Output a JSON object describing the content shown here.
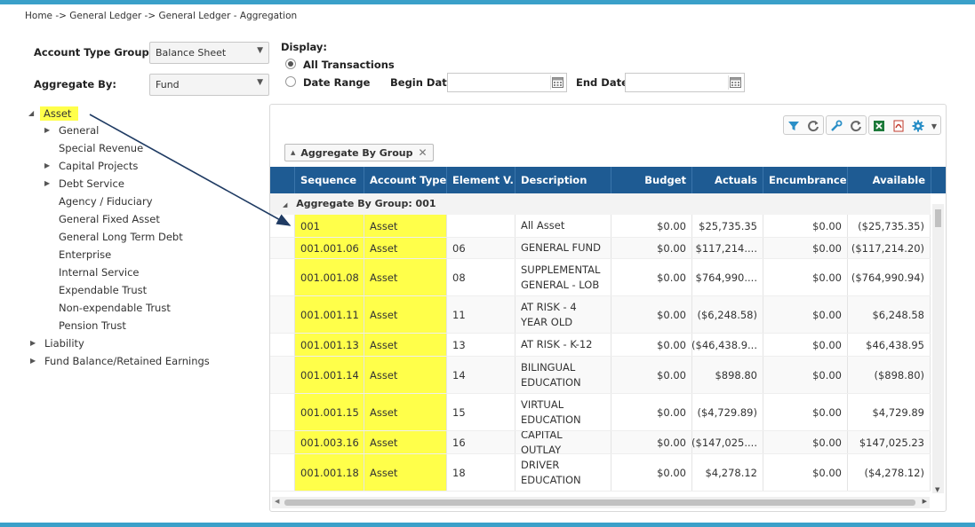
{
  "breadcrumb": "Home -> General Ledger -> General Ledger - Aggregation",
  "filters": {
    "account_type_group_label": "Account Type Group:",
    "account_type_group_value": "Balance Sheet",
    "aggregate_by_label": "Aggregate By:",
    "aggregate_by_value": "Fund",
    "display_label": "Display:",
    "all_transactions_label": "All Transactions",
    "date_range_label": "Date Range",
    "begin_date_label": "Begin Date",
    "end_date_label": "End Date",
    "begin_date_value": "",
    "end_date_value": ""
  },
  "tree": {
    "root": "Asset",
    "children": [
      "General",
      "Special Revenue",
      "Capital Projects",
      "Debt Service",
      "Agency / Fiduciary",
      "General Fixed Asset",
      "General Long Term Debt",
      "Enterprise",
      "Internal Service",
      "Expendable Trust",
      "Non-expendable Trust",
      "Pension Trust"
    ],
    "others": [
      "Liability",
      "Fund Balance/Retained Earnings"
    ]
  },
  "grid": {
    "group_chip": "Aggregate By Group",
    "columns": [
      "Sequence",
      "Account Type",
      "Element V...",
      "Description",
      "Budget",
      "Actuals",
      "Encumbrance",
      "Available"
    ],
    "group_row": "Aggregate By Group: 001",
    "rows": [
      {
        "seq": "001",
        "type": "Asset",
        "elem": "",
        "desc": "All Asset",
        "budget": "$0.00",
        "actuals": "$25,735.35",
        "enc": "$0.00",
        "avail": "($25,735.35)"
      },
      {
        "seq": "001.001.06",
        "type": "Asset",
        "elem": "06",
        "desc": "GENERAL FUND",
        "budget": "$0.00",
        "actuals": "$117,214....",
        "enc": "$0.00",
        "avail": "($117,214.20)"
      },
      {
        "seq": "001.001.08",
        "type": "Asset",
        "elem": "08",
        "desc": "SUPPLEMENTAL GENERAL - LOB",
        "budget": "$0.00",
        "actuals": "$764,990....",
        "enc": "$0.00",
        "avail": "($764,990.94)"
      },
      {
        "seq": "001.001.11",
        "type": "Asset",
        "elem": "11",
        "desc": "AT RISK - 4 YEAR OLD",
        "budget": "$0.00",
        "actuals": "($6,248.58)",
        "enc": "$0.00",
        "avail": "$6,248.58"
      },
      {
        "seq": "001.001.13",
        "type": "Asset",
        "elem": "13",
        "desc": "AT RISK - K-12",
        "budget": "$0.00",
        "actuals": "($46,438.9...",
        "enc": "$0.00",
        "avail": "$46,438.95"
      },
      {
        "seq": "001.001.14",
        "type": "Asset",
        "elem": "14",
        "desc": "BILINGUAL EDUCATION",
        "budget": "$0.00",
        "actuals": "$898.80",
        "enc": "$0.00",
        "avail": "($898.80)"
      },
      {
        "seq": "001.001.15",
        "type": "Asset",
        "elem": "15",
        "desc": "VIRTUAL EDUCATION",
        "budget": "$0.00",
        "actuals": "($4,729.89)",
        "enc": "$0.00",
        "avail": "$4,729.89"
      },
      {
        "seq": "001.003.16",
        "type": "Asset",
        "elem": "16",
        "desc": "CAPITAL OUTLAY",
        "budget": "$0.00",
        "actuals": "($147,025....",
        "enc": "$0.00",
        "avail": "$147,025.23"
      },
      {
        "seq": "001.001.18",
        "type": "Asset",
        "elem": "18",
        "desc": "DRIVER EDUCATION",
        "budget": "$0.00",
        "actuals": "$4,278.12",
        "enc": "$0.00",
        "avail": "($4,278.12)"
      }
    ]
  },
  "colors": {
    "header": "#1e5b93",
    "highlight": "#ffff4a",
    "accent": "#3aa0c9",
    "arrow": "#1f3b63"
  },
  "icons": [
    "filter-icon",
    "refresh-icon",
    "wrench-icon",
    "refresh-icon",
    "excel-icon",
    "pdf-icon",
    "gear-icon",
    "chevron-down-icon"
  ]
}
